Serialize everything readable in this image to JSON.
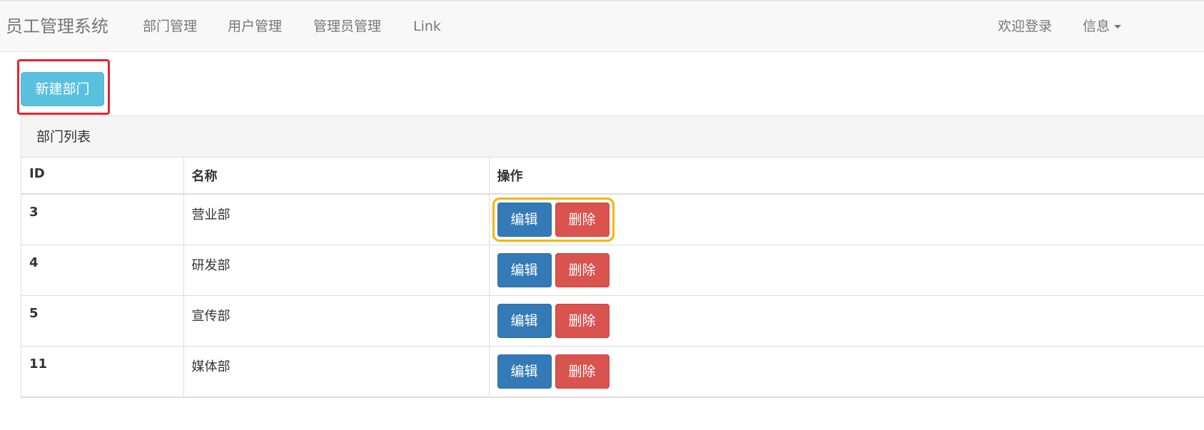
{
  "navbar": {
    "brand": "员工管理系统",
    "links": [
      "部门管理",
      "用户管理",
      "管理员管理",
      "Link"
    ],
    "right_links": [
      "欢迎登录",
      "信息"
    ]
  },
  "toolbar": {
    "new_label": "新建部门"
  },
  "panel": {
    "title": "部门列表"
  },
  "table": {
    "headers": [
      "ID",
      "名称",
      "操作"
    ],
    "rows": [
      {
        "id": "3",
        "name": "营业部"
      },
      {
        "id": "4",
        "name": "研发部"
      },
      {
        "id": "5",
        "name": "宣传部"
      },
      {
        "id": "11",
        "name": "媒体部"
      }
    ],
    "edit_label": "编辑",
    "delete_label": "删除"
  },
  "colors": {
    "info": "#5bc0de",
    "primary": "#337ab7",
    "danger": "#d9534f",
    "highlight_red": "#e8232c",
    "highlight_yellow": "#f5b400"
  }
}
